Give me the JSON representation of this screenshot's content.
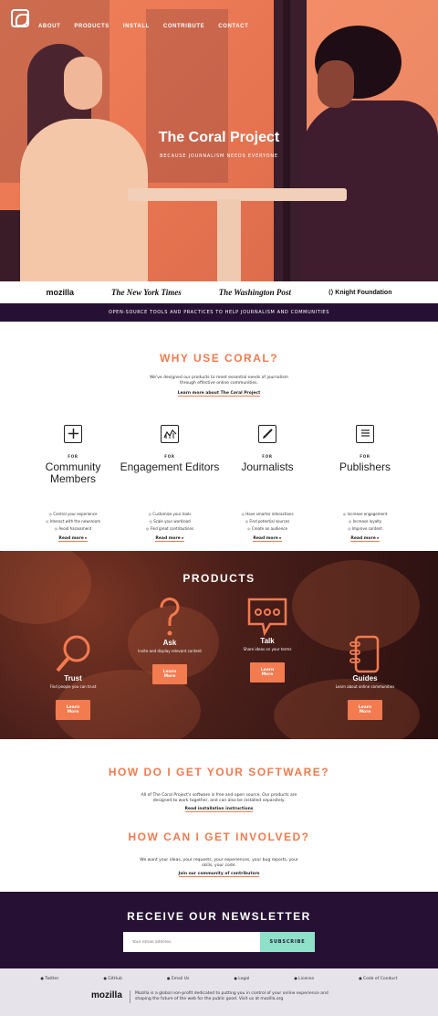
{
  "nav": [
    "ABOUT",
    "PRODUCTS",
    "INSTALL",
    "CONTRIBUTE",
    "CONTACT"
  ],
  "hero": {
    "title": "The Coral Project",
    "subtitle": "BECAUSE JOURNALISM NEEDS EVERYONE"
  },
  "partners": [
    "mozilla",
    "The New York Times",
    "The Washington Post",
    "Knight Foundation"
  ],
  "tagline": "OPEN-SOURCE TOOLS AND PRACTICES TO HELP JOURNALISM AND COMMUNITIES",
  "why": {
    "title": "WHY USE CORAL?",
    "desc": "We've designed our products to meet essential needs of journalism through effective online communities.",
    "link": "Learn more about The Coral Project"
  },
  "audiences": [
    {
      "for": "FOR",
      "name": "Community Members",
      "icon": "plus-icon",
      "items": [
        "Control your experience",
        "Interact with the newsroom",
        "Avoid harassment"
      ],
      "more": "Read more ▸"
    },
    {
      "for": "FOR",
      "name": "Engagement Editors",
      "icon": "chart-icon",
      "items": [
        "Customize your tools",
        "Scale your workload",
        "Find great contributions"
      ],
      "more": "Read more ▸"
    },
    {
      "for": "FOR",
      "name": "Journalists",
      "icon": "pen-icon",
      "items": [
        "Have smarter interactions",
        "Find potential sources",
        "Create an audience"
      ],
      "more": "Read more ▸"
    },
    {
      "for": "FOR",
      "name": "Publishers",
      "icon": "document-icon",
      "items": [
        "Increase engagement",
        "Increase loyalty",
        "Improve content"
      ],
      "more": "Read more ▸"
    }
  ],
  "products": {
    "title": "PRODUCTS",
    "items": [
      {
        "name": "Trust",
        "desc": "Find people you can trust",
        "btn": "Learn More",
        "icon": "magnifier-icon"
      },
      {
        "name": "Ask",
        "desc": "Invite and display relevant content",
        "btn": "Learn More",
        "icon": "question-icon"
      },
      {
        "name": "Talk",
        "desc": "Share ideas on your terms",
        "btn": "Learn More",
        "icon": "speech-bubble-icon"
      },
      {
        "name": "Guides",
        "desc": "Learn about online communities",
        "btn": "Learn More",
        "icon": "notebook-icon"
      }
    ]
  },
  "software": {
    "title": "HOW DO I GET YOUR SOFTWARE?",
    "desc": "All of The Coral Project's software is free and open source. Our products are designed to work together, and can also be installed separately.",
    "link": "Read installation instructions"
  },
  "involved": {
    "title": "HOW CAN I GET INVOLVED?",
    "desc": "We want your ideas, your requests, your experiences, your bug reports, your skills, your code.",
    "link": "Join our community of contributors"
  },
  "newsletter": {
    "title": "RECEIVE OUR NEWSLETTER",
    "placeholder": "Your email address",
    "button": "SUBSCRIBE"
  },
  "footer": {
    "links": [
      "Twitter",
      "GitHub",
      "Email Us",
      "Legal",
      "License",
      "Code of Conduct"
    ],
    "brand": "mozilla",
    "text": "Mozilla is a global non-profit dedicated to putting you in control of your online experience and shaping the future of the web for the public good. Visit us at mozilla.org"
  },
  "colors": {
    "accent": "#f27b50",
    "dark": "#261134",
    "mint": "#8ee0c8"
  }
}
